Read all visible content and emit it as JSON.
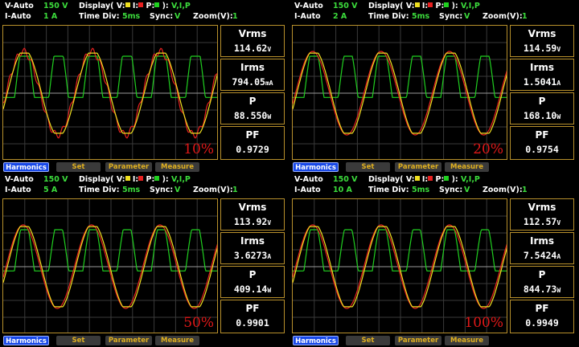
{
  "panels": [
    {
      "v_mode": "V-Auto",
      "v_range": "150 V",
      "i_mode": "I-Auto",
      "i_range": "1 A",
      "display_label": "Display( V:",
      "display_i": " I:",
      "display_p": " P:",
      "display_tail": " ): ",
      "display_value": "V,I,P",
      "timediv_label": "Time  Div:",
      "timediv_value": "5ms",
      "sync_label": "Sync:",
      "sync_value": "V",
      "zoom_label": "Zoom(V):",
      "zoom_value": "1",
      "vrms_label": "Vrms",
      "vrms_value": "114.62",
      "vrms_unit": "V",
      "irms_label": "Irms",
      "irms_value": "794.05",
      "irms_unit": "mA",
      "p_label": "P",
      "p_value": "88.550",
      "p_unit": "W",
      "pf_label": "PF",
      "pf_value": "0.9729",
      "load_pct": "10%"
    },
    {
      "v_mode": "V-Auto",
      "v_range": "150 V",
      "i_mode": "I-Auto",
      "i_range": "2 A",
      "display_label": "Display( V:",
      "display_i": " I:",
      "display_p": " P:",
      "display_tail": " ): ",
      "display_value": "V,I,P",
      "timediv_label": "Time  Div:",
      "timediv_value": "5ms",
      "sync_label": "Sync:",
      "sync_value": "V",
      "zoom_label": "Zoom(V):",
      "zoom_value": "1",
      "vrms_label": "Vrms",
      "vrms_value": "114.59",
      "vrms_unit": "V",
      "irms_label": "Irms",
      "irms_value": "1.5041",
      "irms_unit": "A",
      "p_label": "P",
      "p_value": "168.10",
      "p_unit": "W",
      "pf_label": "PF",
      "pf_value": "0.9754",
      "load_pct": "20%"
    },
    {
      "v_mode": "V-Auto",
      "v_range": "150 V",
      "i_mode": "I-Auto",
      "i_range": "5 A",
      "display_label": "Display( V:",
      "display_i": " I:",
      "display_p": " P:",
      "display_tail": " ): ",
      "display_value": "V,I,P",
      "timediv_label": "Time  Div:",
      "timediv_value": "5ms",
      "sync_label": "Sync:",
      "sync_value": "V",
      "zoom_label": "Zoom(V):",
      "zoom_value": "1",
      "vrms_label": "Vrms",
      "vrms_value": "113.92",
      "vrms_unit": "V",
      "irms_label": "Irms",
      "irms_value": "3.6273",
      "irms_unit": "A",
      "p_label": "P",
      "p_value": "409.14",
      "p_unit": "W",
      "pf_label": "PF",
      "pf_value": "0.9901",
      "load_pct": "50%"
    },
    {
      "v_mode": "V-Auto",
      "v_range": "150 V",
      "i_mode": "I-Auto",
      "i_range": "10 A",
      "display_label": "Display( V:",
      "display_i": " I:",
      "display_p": " P:",
      "display_tail": " ): ",
      "display_value": "V,I,P",
      "timediv_label": "Time  Div:",
      "timediv_value": "5ms",
      "sync_label": "Sync:",
      "sync_value": "V",
      "zoom_label": "Zoom(V):",
      "zoom_value": "1",
      "vrms_label": "Vrms",
      "vrms_value": "112.57",
      "vrms_unit": "V",
      "irms_label": "Irms",
      "irms_value": "7.5424",
      "irms_unit": "A",
      "p_label": "P",
      "p_value": "844.73",
      "p_unit": "W",
      "pf_label": "PF",
      "pf_value": "0.9949",
      "load_pct": "100%"
    }
  ],
  "buttons": {
    "harmonics": "Harmonics",
    "set": "Set",
    "parameter": "Parameter",
    "measure": "Measure"
  },
  "colors": {
    "voltage": "#f0e020",
    "current": "#e82020",
    "power": "#20d020",
    "frame": "#b8902c",
    "grid": "#3a3a3a",
    "harmonics_button": "#1848e8"
  },
  "icons": [
    "voltage-color-swatch-icon",
    "current-color-swatch-icon",
    "power-color-swatch-icon"
  ]
}
